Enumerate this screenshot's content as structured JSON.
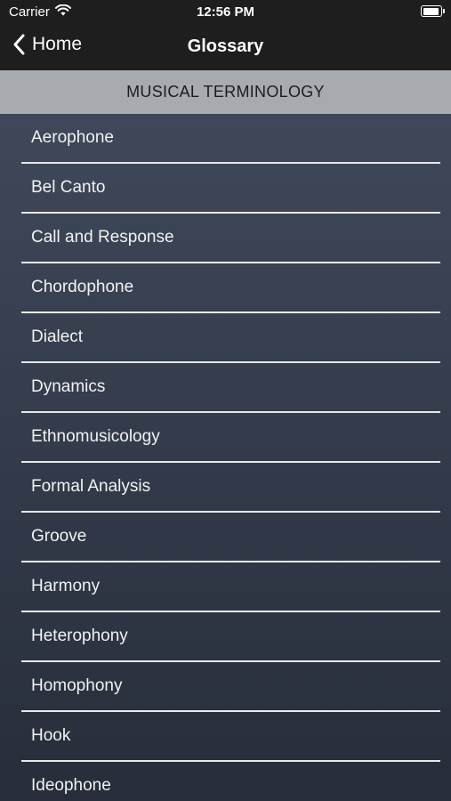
{
  "status_bar": {
    "carrier": "Carrier",
    "time": "12:56 PM",
    "icons": [
      "wifi-icon",
      "battery-icon"
    ]
  },
  "nav": {
    "back_label": "Home",
    "title": "Glossary",
    "back_icon": "chevron-left-icon"
  },
  "section": {
    "header": "MUSICAL TERMINOLOGY"
  },
  "terms": [
    "Aerophone",
    "Bel Canto",
    "Call and Response",
    "Chordophone",
    "Dialect",
    "Dynamics",
    "Ethnomusicology",
    "Formal Analysis",
    "Groove",
    "Harmony",
    "Heterophony",
    "Homophony",
    "Hook",
    "Ideophone"
  ],
  "colors": {
    "bar_background": "#1e1e1e",
    "section_header": "#a7abb0",
    "list_top": "#3f4859",
    "list_bottom": "#272d3a",
    "separator": "#e7e8ea"
  }
}
